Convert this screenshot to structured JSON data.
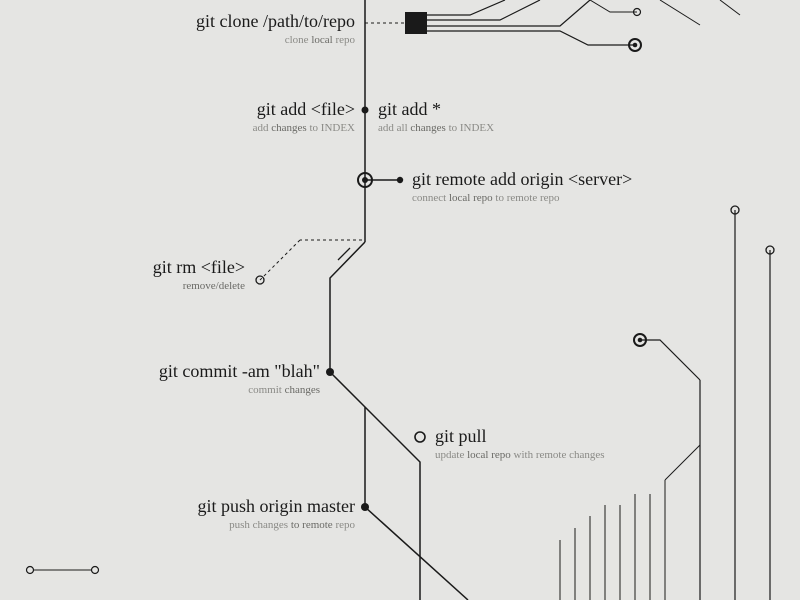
{
  "nodes": {
    "clone": {
      "cmd": "git clone /path/to/repo",
      "desc_pre": "clone ",
      "desc_em": "local",
      "desc_post": " repo"
    },
    "add_file": {
      "cmd": "git add <file>",
      "desc_pre": "add ",
      "desc_em": "changes",
      "desc_post": " to INDEX"
    },
    "add_all": {
      "cmd": "git add *",
      "desc_pre": "add all ",
      "desc_em": "changes",
      "desc_post": " to INDEX"
    },
    "remote_add": {
      "cmd": "git remote add origin <server>",
      "desc_pre": "connect ",
      "desc_em": "local repo",
      "desc_post": " to remote repo"
    },
    "rm": {
      "cmd": "git rm <file>",
      "desc_pre": "",
      "desc_em": "remove/delete",
      "desc_post": ""
    },
    "commit": {
      "cmd": "git commit -am \"blah\"",
      "desc_pre": "commit ",
      "desc_em": "changes",
      "desc_post": ""
    },
    "pull": {
      "cmd": "git pull",
      "desc_pre": "update ",
      "desc_em": "local repo",
      "desc_post": " with remote changes"
    },
    "push": {
      "cmd": "git push origin master",
      "desc_pre": "push changes ",
      "desc_em": "to remote",
      "desc_post": " repo"
    }
  }
}
